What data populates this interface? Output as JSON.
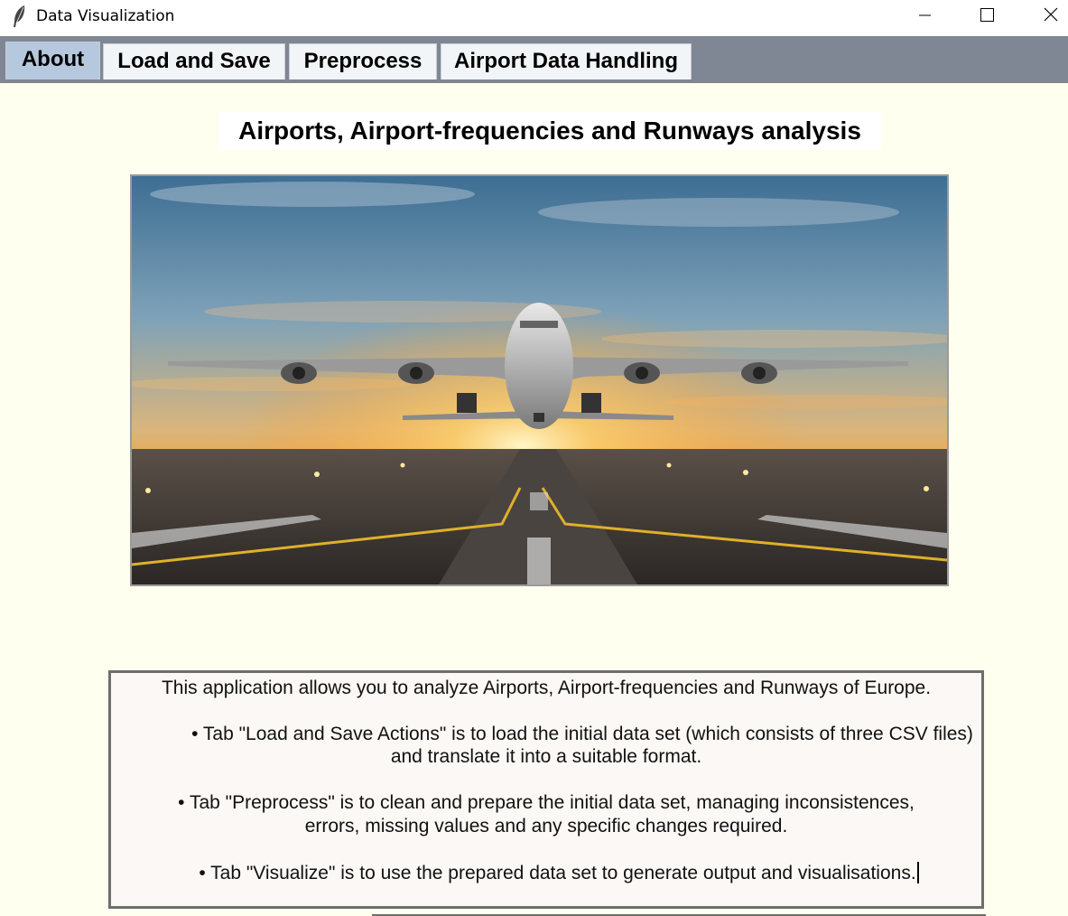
{
  "window": {
    "title": "Data Visualization",
    "icon": "feather-icon",
    "controls": [
      "minimize-icon",
      "maximize-icon",
      "close-icon"
    ]
  },
  "tabs": [
    {
      "label": "About",
      "active": true
    },
    {
      "label": "Load and Save",
      "active": false
    },
    {
      "label": "Preprocess",
      "active": false
    },
    {
      "label": "Airport Data Handling",
      "active": false
    }
  ],
  "about": {
    "heading": "Airports, Airport-frequencies and Runways analysis",
    "image": "airplane taking off over runway at sunset",
    "description": {
      "intro": "This application allows you to analyze Airports, Airport-frequencies and Runways of Europe.",
      "bullet1_line1": "• Tab \"Load and Save Actions\" is to load the initial data set (which consists of three CSV files)",
      "bullet1_line2": "and translate it into a suitable format.",
      "bullet2_line1": "• Tab \"Preprocess\" is to clean and prepare the initial data set, managing inconsistences,",
      "bullet2_line2": "errors, missing values and any specific changes required.",
      "bullet3": "• Tab \"Visualize\" is to use the prepared data set to generate output and visualisations."
    }
  },
  "colors": {
    "tab_strip": "#7f8794",
    "active_tab": "#b6c8de",
    "content_bg": "#fffff0",
    "textbox_bg": "#fcf8f6"
  }
}
